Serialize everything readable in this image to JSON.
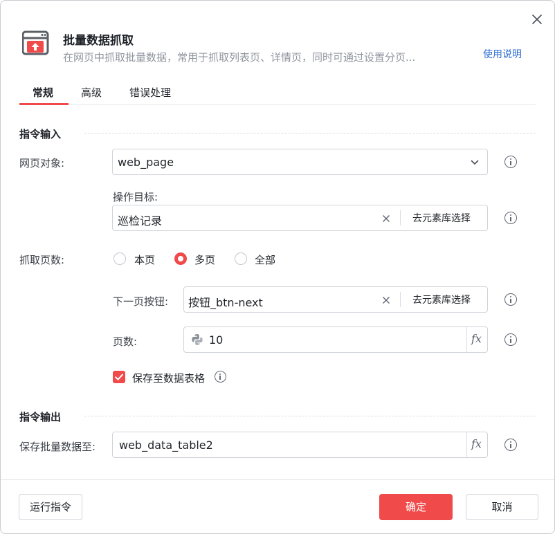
{
  "header": {
    "title": "批量数据抓取",
    "subtitle": "在网页中抓取批量数据，常用于抓取列表页、详情页，同时可通过设置分页...",
    "help_link": "使用说明",
    "icon": "browser-upload-icon"
  },
  "tabs": [
    {
      "label": "常规",
      "active": true
    },
    {
      "label": "高级",
      "active": false
    },
    {
      "label": "错误处理",
      "active": false
    }
  ],
  "input_section": {
    "title": "指令输入",
    "web_object": {
      "label": "网页对象:",
      "value": "web_page"
    },
    "target": {
      "label": "操作目标:",
      "value": "巡检记录",
      "select_button": "去元素库选择"
    },
    "page_count_mode": {
      "label": "抓取页数:",
      "options": [
        {
          "label": "本页",
          "checked": false
        },
        {
          "label": "多页",
          "checked": true
        },
        {
          "label": "全部",
          "checked": false
        }
      ]
    },
    "next_button": {
      "label": "下一页按钮:",
      "value": "按钮_btn-next",
      "select_button": "去元素库选择"
    },
    "pages": {
      "label": "页数:",
      "value": "10",
      "icon": "python-icon"
    },
    "save_to_table": {
      "label": "保存至数据表格",
      "checked": true
    }
  },
  "output_section": {
    "title": "指令输出",
    "save_to": {
      "label": "保存批量数据至:",
      "value": "web_data_table2"
    }
  },
  "footer": {
    "run_button": "运行指令",
    "confirm_button": "确定",
    "cancel_button": "取消"
  },
  "colors": {
    "accent": "#f04a4a",
    "link": "#2b6cd4",
    "text": "#1f2329",
    "muted": "#8f959e"
  }
}
